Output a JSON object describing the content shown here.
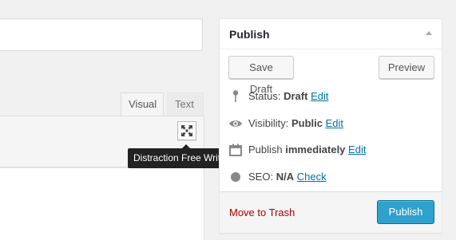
{
  "editor": {
    "tabs": [
      {
        "label": "Visual"
      },
      {
        "label": "Text"
      }
    ],
    "dfw_tooltip": "Distraction Free Writing"
  },
  "publish": {
    "title": "Publish",
    "save_draft_label": "Save Draft",
    "preview_label": "Preview",
    "status": {
      "label": "Status:",
      "value": "Draft",
      "link": "Edit"
    },
    "visibility": {
      "label": "Visibility:",
      "value": "Public",
      "link": "Edit"
    },
    "schedule": {
      "label": "Publish",
      "value": "immediately",
      "link": "Edit"
    },
    "seo": {
      "label": "SEO:",
      "value": "N/A",
      "link": "Check"
    },
    "trash_label": "Move to Trash",
    "publish_label": "Publish"
  },
  "colors": {
    "link": "#0073aa",
    "trash": "#aa0000",
    "publish_button": "#2ea2cc",
    "background": "#f1f1f1"
  },
  "icons": [
    "fullscreen-icon",
    "pin-icon",
    "eye-icon",
    "calendar-icon",
    "seo-dot-icon",
    "collapse-arrow-icon"
  ]
}
